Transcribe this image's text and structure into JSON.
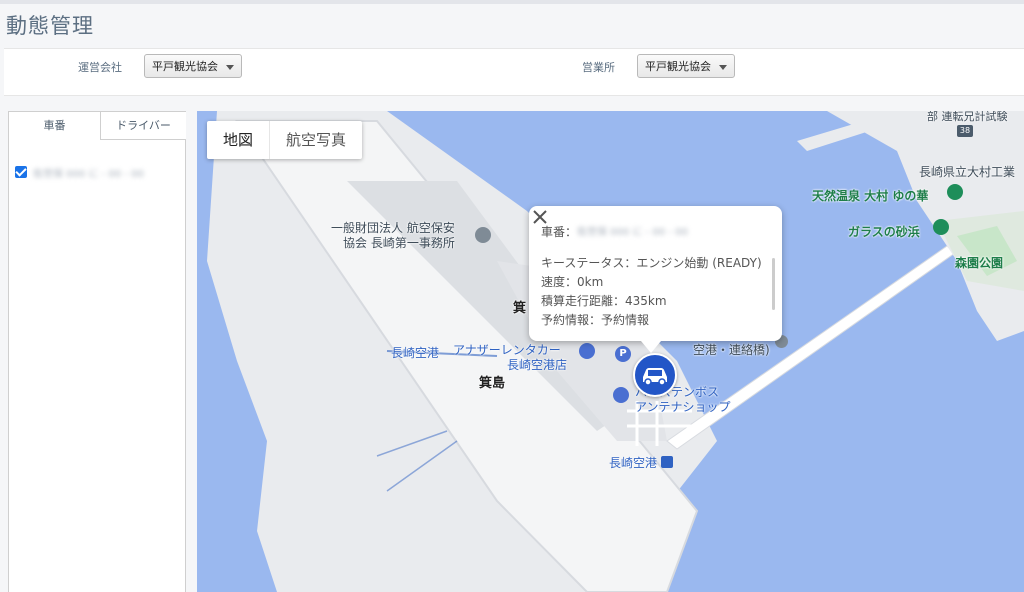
{
  "page": {
    "title": "動態管理"
  },
  "filters": {
    "company_label": "運営会社",
    "company_value": "平戸観光協会",
    "office_label": "営業所",
    "office_value": "平戸観光協会"
  },
  "side": {
    "tabs": [
      "車番",
      "ドライバー"
    ],
    "vehicle_label": "佐世保 000 に - 00 - 00"
  },
  "map": {
    "type_buttons": [
      "地図",
      "航空写真"
    ],
    "labels": {
      "aviation_office": "一般財団法人 航空保安\n協会 長崎第一事務所",
      "airport_jp": "長崎空港",
      "rental": "アナザーレンタカー",
      "rental2": "長崎空港店",
      "island": "箕島",
      "island_partial": "箕",
      "huis": "ハウステンボス",
      "antenna": "アンテナショップ",
      "airport_bus": "長崎空港",
      "connect": "空港・連絡橋)",
      "onsen": "天然温泉 大村 ゆの華",
      "sand": "ガラスの砂浜",
      "park": "森園公園",
      "school": "長崎県立大村工業",
      "route": "38",
      "topright": "部 連転兄計試験"
    },
    "popup": {
      "car_label": "車番：",
      "car_value": "佐世保 000 に - 00 - 00",
      "status": "キーステータス：エンジン始動 (READY)",
      "speed": "速度：0km",
      "distance": "積算走行距離：435km",
      "booking": "予約情報：予約情報"
    },
    "colors": {
      "water": "#9ab8ef",
      "land": "#e9ebee",
      "road": "#ffffff",
      "marker": "#2356c7"
    }
  }
}
